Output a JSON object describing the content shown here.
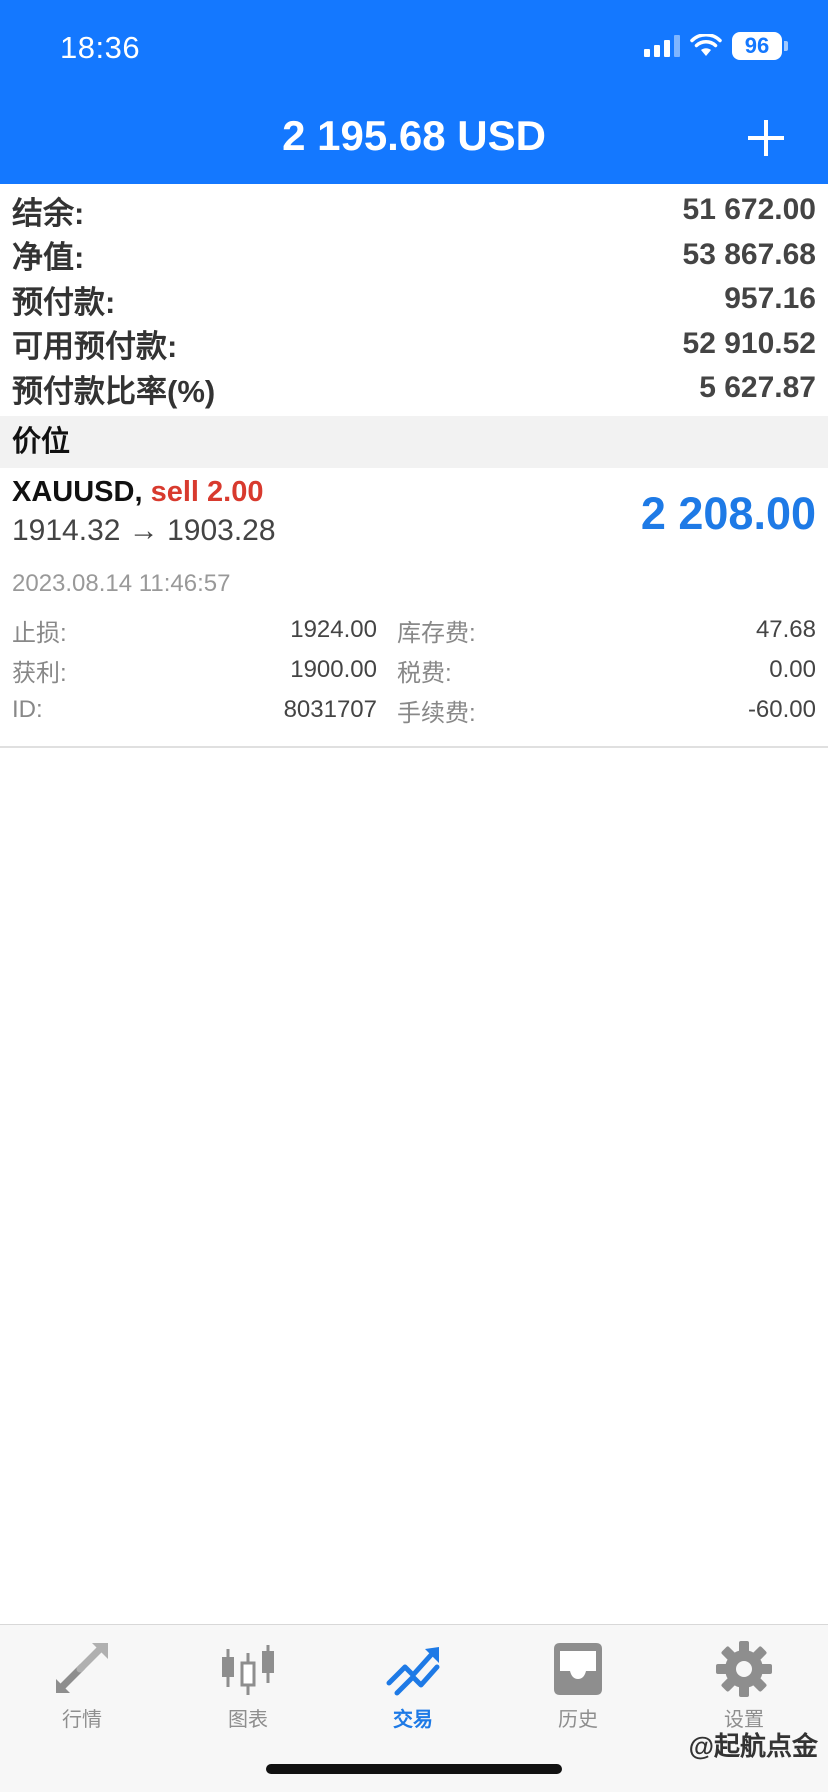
{
  "status_bar": {
    "time": "18:36",
    "battery": "96"
  },
  "header": {
    "title": "2 195.68 USD",
    "add_icon": "plus-icon"
  },
  "summary": [
    {
      "label": "结余:",
      "value": "51 672.00"
    },
    {
      "label": "净值:",
      "value": "53 867.68"
    },
    {
      "label": "预付款:",
      "value": "957.16"
    },
    {
      "label": "可用预付款:",
      "value": "52 910.52"
    },
    {
      "label": "预付款比率(%)",
      "value": "5 627.87"
    }
  ],
  "section": {
    "title": "价位"
  },
  "position": {
    "symbol": "XAUUSD,",
    "side": "sell 2.00",
    "prices": "1914.32 → 1903.28",
    "profit": "2 208.00",
    "time": "2023.08.14 11:46:57",
    "details": [
      {
        "label1": "止损:",
        "value1": "1924.00",
        "label2": "库存费:",
        "value2": "47.68"
      },
      {
        "label1": "获利:",
        "value1": "1900.00",
        "label2": "税费:",
        "value2": "0.00"
      },
      {
        "label1": "ID:",
        "value1": "8031707",
        "label2": "手续费:",
        "value2": "-60.00"
      }
    ]
  },
  "tabbar": {
    "items": [
      {
        "label": "行情",
        "icon": "quotes-icon",
        "active": false
      },
      {
        "label": "图表",
        "icon": "candlestick-icon",
        "active": false
      },
      {
        "label": "交易",
        "icon": "trade-icon",
        "active": true
      },
      {
        "label": "历史",
        "icon": "history-icon",
        "active": false
      },
      {
        "label": "设置",
        "icon": "gear-icon",
        "active": false
      }
    ]
  },
  "watermark": "@起航点金",
  "colors": {
    "accent": "#1478ff",
    "profit": "#1e7ae6",
    "sell": "#d83a2e"
  }
}
